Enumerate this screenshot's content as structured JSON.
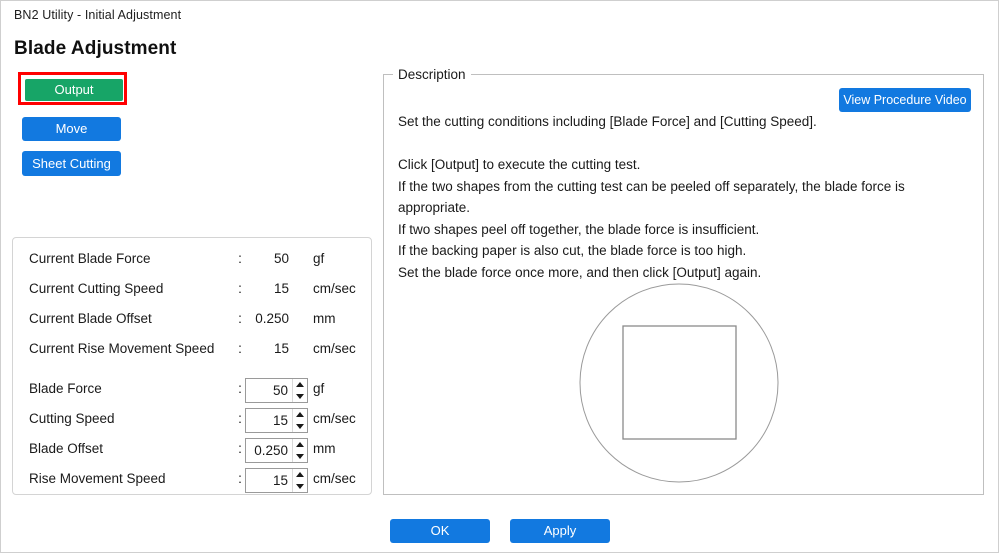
{
  "window": {
    "title": "BN2 Utility - Initial Adjustment",
    "page_title": "Blade Adjustment"
  },
  "colors": {
    "accent_blue": "#1279e0",
    "output_green": "#17a567",
    "focus_red": "#ff0000",
    "card_border": "#d4d4d4",
    "group_border": "#bfbfbf",
    "shape_stroke": "#808080"
  },
  "actions": {
    "output_label": "Output",
    "move_label": "Move",
    "sheet_cutting_label": "Sheet Cutting"
  },
  "current_values": {
    "rows": [
      {
        "label": "Current Blade Force",
        "separator": ":",
        "value": "50",
        "unit": "gf"
      },
      {
        "label": "Current Cutting Speed",
        "separator": ":",
        "value": "15",
        "unit": "cm/sec"
      },
      {
        "label": "Current Blade Offset",
        "separator": ":",
        "value": "0.250",
        "unit": "mm"
      },
      {
        "label": "Current Rise Movement Speed",
        "separator": ":",
        "value": "15",
        "unit": "cm/sec"
      }
    ]
  },
  "settings": {
    "rows": [
      {
        "label": "Blade Force",
        "separator": ":",
        "value": "50",
        "unit": "gf"
      },
      {
        "label": "Cutting Speed",
        "separator": ":",
        "value": "15",
        "unit": "cm/sec"
      },
      {
        "label": "Blade Offset",
        "separator": ":",
        "value": "0.250",
        "unit": "mm"
      },
      {
        "label": "Rise Movement Speed",
        "separator": ":",
        "value": "15",
        "unit": "cm/sec"
      }
    ],
    "spinner_up_icon": "triangle-up-icon",
    "spinner_down_icon": "triangle-down-icon"
  },
  "description": {
    "legend": "Description",
    "video_button_label": "View Procedure Video",
    "body": "Set the cutting conditions including [Blade Force] and [Cutting Speed].\n\nClick [Output] to execute the cutting test.\nIf the two shapes from the cutting test can be peeled off separately, the blade force is appropriate.\nIf two shapes peel off together, the blade force is insufficient.\nIf the backing paper is also cut, the blade force is too high.\nSet the blade force once more, and then click [Output] again."
  },
  "diagram": {
    "name": "cutting-test-shapes",
    "outer_shape": "circle",
    "inner_shape": "square"
  },
  "footer": {
    "ok_label": "OK",
    "apply_label": "Apply"
  }
}
